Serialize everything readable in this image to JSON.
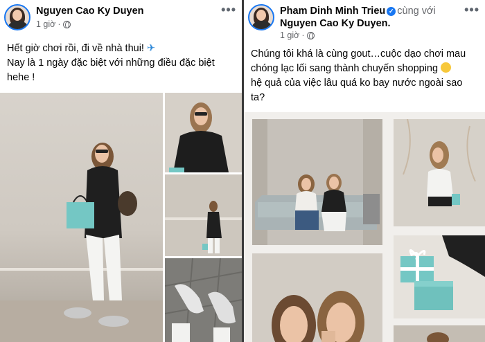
{
  "posts": [
    {
      "author": "Nguyen Cao Ky Duyen",
      "time": "1 giờ",
      "menu": "•••",
      "lines": [
        "Hết giờ chơi rồi, đi về nhà thui!",
        "Nay là 1 ngày đặc biệt với những điều đặc biệt",
        "hehe !"
      ],
      "emoji_icon": "airplane-icon",
      "photos": 4
    },
    {
      "author": "Pham Dinh Minh Trieu",
      "with_label": "cùng với",
      "tagged": "Nguyen Cao Ky Duyen",
      "tagged_suffix": ".",
      "time": "1 giờ",
      "menu": "•••",
      "lines": [
        "Chúng tôi khá là cùng gout…cuộc dạo chơi mau",
        "chóng lạc lối sang thành chuyến shopping",
        "hệ quả của việc lâu quá ko bay nước ngoài sao",
        "ta?"
      ],
      "emoji_icon": "laughing-face-icon"
    }
  ],
  "colors": {
    "accent": "#1877f2",
    "text": "#050505",
    "muted": "#65676b",
    "tiffany_blue": "#74c7c4"
  }
}
